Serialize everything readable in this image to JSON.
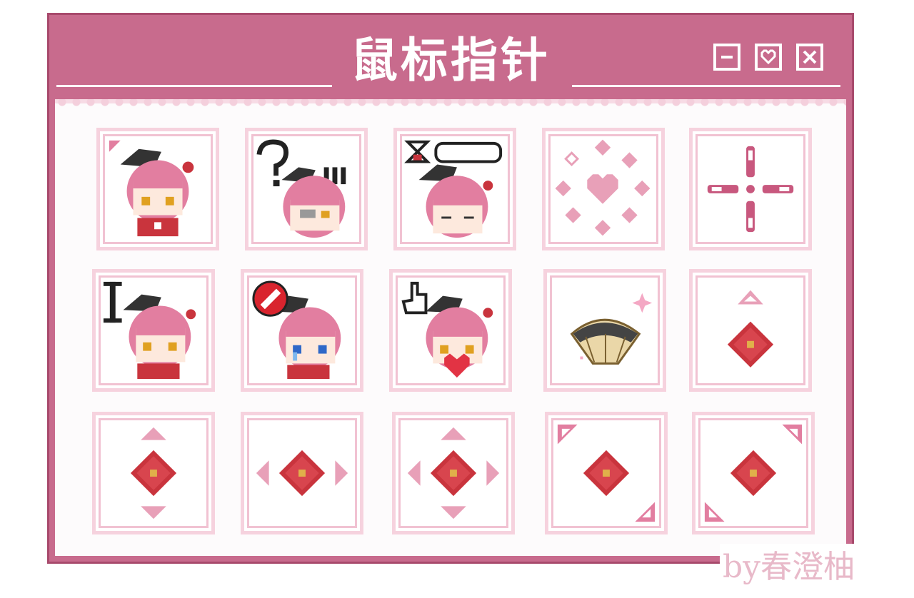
{
  "window": {
    "title": "鼠标指针",
    "controls": [
      {
        "name": "minimize-button",
        "icon": "minimize-icon"
      },
      {
        "name": "favorite-button",
        "icon": "heart-icon"
      },
      {
        "name": "close-button",
        "icon": "close-icon"
      }
    ]
  },
  "colors": {
    "frame": "#c86b8d",
    "frame_dark": "#a84a6c",
    "panel": "#fdfbfc",
    "tile_border": "#f6d2de",
    "accent_pink": "#e27ea0",
    "gem_red": "#c9343d",
    "gem_gold": "#e0b04a"
  },
  "cursors": [
    {
      "name": "cursor-normal-select",
      "icon": "character-icon"
    },
    {
      "name": "cursor-help-select",
      "icon": "character-question-icon"
    },
    {
      "name": "cursor-working-in-background",
      "icon": "character-hourglass-icon"
    },
    {
      "name": "cursor-busy",
      "icon": "heart-spinner-icon"
    },
    {
      "name": "cursor-precision-select",
      "icon": "crosshair-icon"
    },
    {
      "name": "cursor-text-select",
      "icon": "character-ibeam-icon"
    },
    {
      "name": "cursor-unavailable",
      "icon": "character-forbidden-icon"
    },
    {
      "name": "cursor-link-select",
      "icon": "character-hand-icon"
    },
    {
      "name": "cursor-handwriting",
      "icon": "fan-icon"
    },
    {
      "name": "cursor-alternate-select",
      "icon": "gem-up-arrow-icon"
    },
    {
      "name": "cursor-vertical-resize",
      "icon": "gem-vertical-icon"
    },
    {
      "name": "cursor-horizontal-resize",
      "icon": "gem-horizontal-icon"
    },
    {
      "name": "cursor-move",
      "icon": "gem-move-icon"
    },
    {
      "name": "cursor-diagonal-resize-1",
      "icon": "gem-diagonal-nwse-icon"
    },
    {
      "name": "cursor-diagonal-resize-2",
      "icon": "gem-diagonal-nesw-icon"
    }
  ],
  "credit": "by春澄柚"
}
